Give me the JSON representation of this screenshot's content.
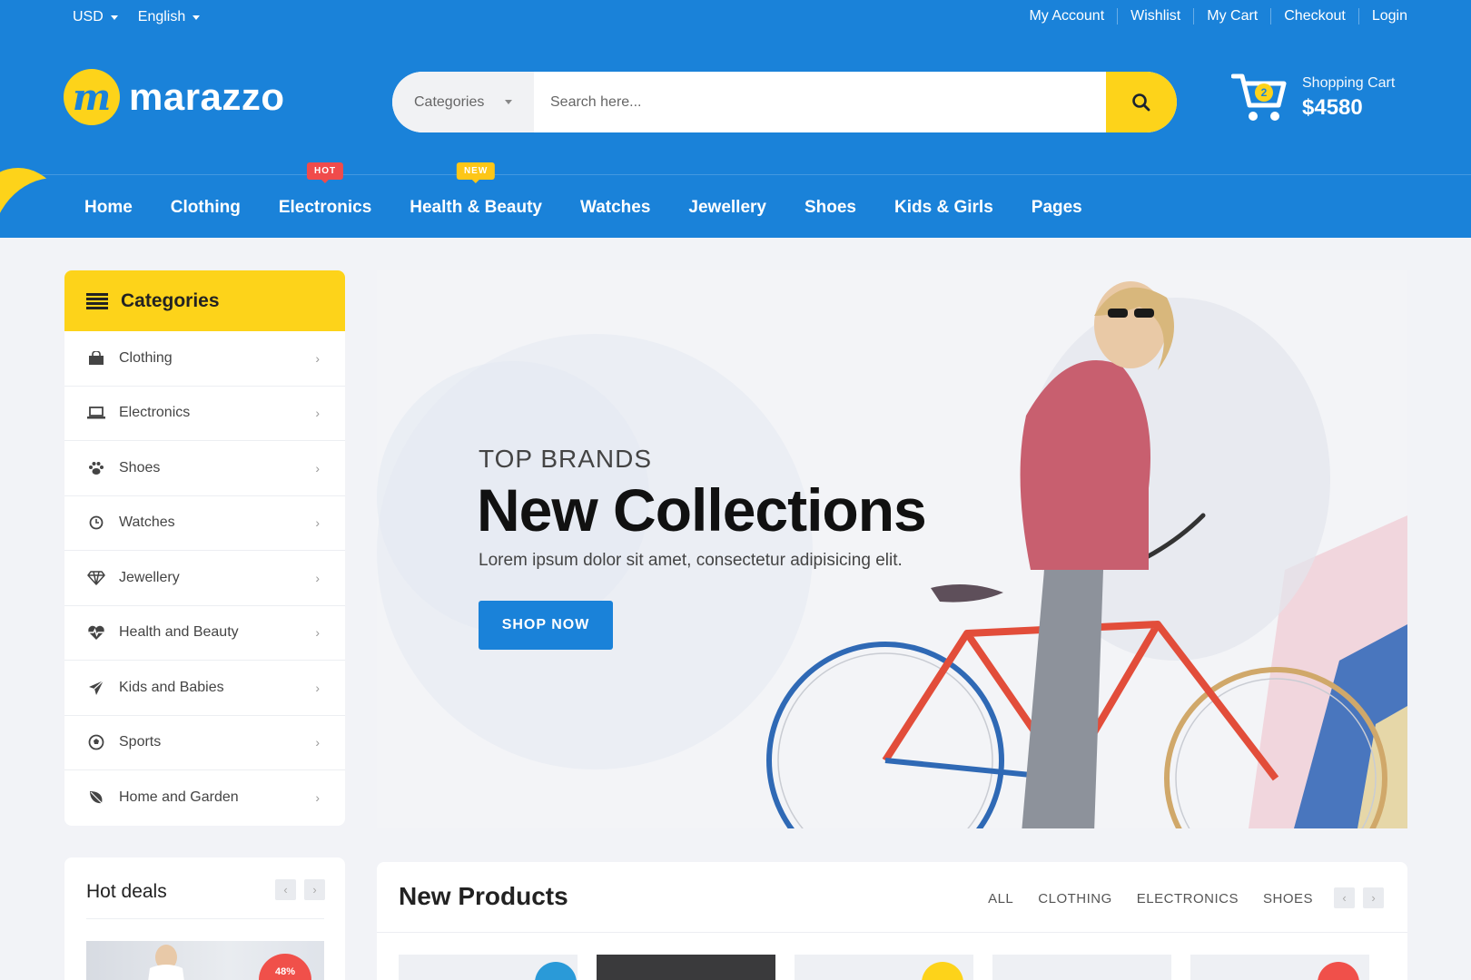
{
  "topbar": {
    "currency": "USD",
    "language": "English",
    "links": [
      "My Account",
      "Wishlist",
      "My Cart",
      "Checkout",
      "Login"
    ]
  },
  "logo": {
    "letter": "m",
    "text": "marazzo"
  },
  "search": {
    "category": "Categories",
    "placeholder": "Search here..."
  },
  "cart": {
    "count": "2",
    "label": "Shopping Cart",
    "total": "$4580"
  },
  "nav": {
    "items": [
      {
        "label": "Home",
        "active": true
      },
      {
        "label": "Clothing"
      },
      {
        "label": "Electronics",
        "tag": "HOT"
      },
      {
        "label": "Health & Beauty",
        "tag": "NEW"
      },
      {
        "label": "Watches"
      },
      {
        "label": "Jewellery"
      },
      {
        "label": "Shoes"
      },
      {
        "label": "Kids & Girls"
      },
      {
        "label": "Pages"
      }
    ]
  },
  "sidebar": {
    "title": "Categories",
    "items": [
      {
        "label": "Clothing",
        "icon": "shopping-bag-icon"
      },
      {
        "label": "Electronics",
        "icon": "laptop-icon"
      },
      {
        "label": "Shoes",
        "icon": "paw-icon"
      },
      {
        "label": "Watches",
        "icon": "clock-icon"
      },
      {
        "label": "Jewellery",
        "icon": "diamond-icon"
      },
      {
        "label": "Health and Beauty",
        "icon": "heartbeat-icon"
      },
      {
        "label": "Kids and Babies",
        "icon": "paper-plane-icon"
      },
      {
        "label": "Sports",
        "icon": "soccer-ball-icon"
      },
      {
        "label": "Home and Garden",
        "icon": "leaf-icon"
      }
    ]
  },
  "hero": {
    "subtitle": "TOP BRANDS",
    "title": "New Collections",
    "text": "Lorem ipsum dolor sit amet, consectetur adipisicing elit.",
    "button": "SHOP NOW"
  },
  "hotdeals": {
    "title": "Hot deals",
    "badge": "48%"
  },
  "newproducts": {
    "title": "New Products",
    "tabs": [
      "ALL",
      "CLOTHING",
      "ELECTRONICS",
      "SHOES"
    ]
  },
  "colors": {
    "primary": "#1a82d9",
    "accent": "#fdd31a",
    "hot": "#f04b4b",
    "new": "#fdc617"
  }
}
